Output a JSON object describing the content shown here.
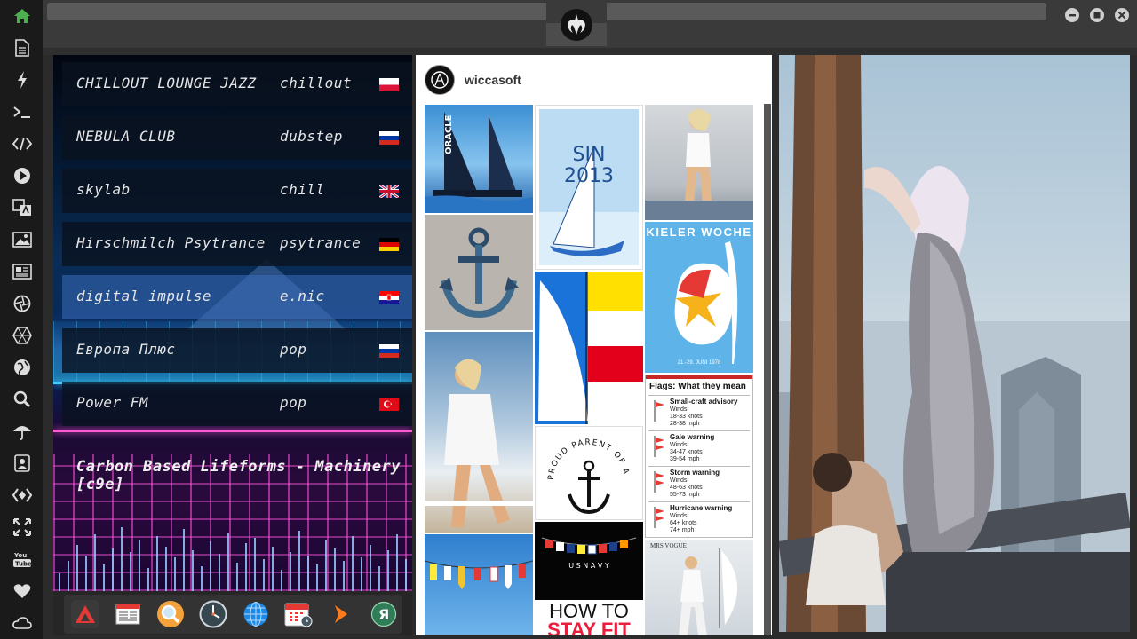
{
  "app": {
    "title": ""
  },
  "launcher": {
    "items": [
      {
        "name": "home-icon",
        "color": "#4caf50"
      },
      {
        "name": "document-icon"
      },
      {
        "name": "flash-icon"
      },
      {
        "name": "terminal-icon"
      },
      {
        "name": "code-icon"
      },
      {
        "name": "play-icon"
      },
      {
        "name": "translate-icon"
      },
      {
        "name": "image-icon"
      },
      {
        "name": "news-icon"
      },
      {
        "name": "aperture-icon"
      },
      {
        "name": "hexagon-icon"
      },
      {
        "name": "globe-icon"
      },
      {
        "name": "search-icon"
      },
      {
        "name": "umbrella-icon"
      },
      {
        "name": "contacts-icon"
      },
      {
        "name": "diamond-code-icon"
      },
      {
        "name": "fullscreen-icon"
      },
      {
        "name": "youtube-icon"
      },
      {
        "name": "heart-icon"
      },
      {
        "name": "cloud-icon"
      }
    ]
  },
  "radio": {
    "stations": [
      {
        "name": "CHILLOUT LOUNGE JAZZ",
        "genre": "chillout",
        "flag": "PL"
      },
      {
        "name": "NEBULA CLUB",
        "genre": "dubstep",
        "flag": "RU"
      },
      {
        "name": "skylab",
        "genre": "chill",
        "flag": "GB"
      },
      {
        "name": "Hirschmilch Psytrance",
        "genre": "psytrance",
        "flag": "DE"
      },
      {
        "name": "digital impulse",
        "genre": "e.nic",
        "flag": "HR"
      },
      {
        "name": "Европа Плюс",
        "genre": "pop",
        "flag": "RU"
      },
      {
        "name": "Power FM",
        "genre": "pop",
        "flag": "TR"
      }
    ],
    "now_playing": "Carbon Based Lifeforms - Machinery [c9e]"
  },
  "pinterest": {
    "username": "wiccasoft",
    "tiles": {
      "sin_title": "SIN",
      "sin_year": "2013",
      "kieler": "KIELER WOCHE",
      "kieler_date": "21.-29. JUNI 1978",
      "flags_title": "Flags: What they mean",
      "flags": [
        {
          "label": "Small-craft advisory",
          "winds": "Winds:",
          "a": "18-33 knots",
          "b": "28-38 mph"
        },
        {
          "label": "Gale warning",
          "winds": "Winds:",
          "a": "34-47 knots",
          "b": "39-54 mph"
        },
        {
          "label": "Storm warning",
          "winds": "Winds:",
          "a": "48-63 knots",
          "b": "55-73 mph"
        },
        {
          "label": "Hurricane warning",
          "winds": "Winds:",
          "a": "64+ knots",
          "b": "74+ mph"
        }
      ],
      "sailor_text": "PROUD PARENT OF A U.S. SAILOR",
      "navy_text": "U S   N A V Y",
      "stayfit_a": "HOW TO",
      "stayfit_b": "STAY FIT",
      "mrsvogue": "MRS VOGUE"
    }
  }
}
